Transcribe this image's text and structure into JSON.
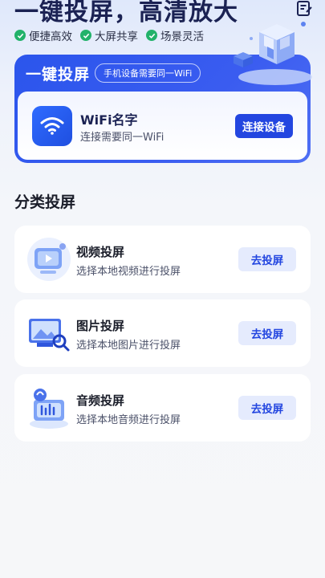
{
  "hero": {
    "title": "一键投屏，高清放大",
    "features": [
      "便捷高效",
      "大屏共享",
      "场景灵活"
    ]
  },
  "cast": {
    "title": "一键投屏",
    "tip": "手机设备需要同一WiFi",
    "wifi_name": "WiFi名字",
    "wifi_sub": "连接需要同一WiFi",
    "connect_label": "连接设备"
  },
  "section": {
    "title": "分类投屏"
  },
  "categories": [
    {
      "title": "视频投屏",
      "subtitle": "选择本地视频进行投屏",
      "button": "去投屏",
      "icon": "video-cast-icon"
    },
    {
      "title": "图片投屏",
      "subtitle": "选择本地图片进行投屏",
      "button": "去投屏",
      "icon": "image-cast-icon"
    },
    {
      "title": "音频投屏",
      "subtitle": "选择本地音频进行投屏",
      "button": "去投屏",
      "icon": "audio-cast-icon"
    }
  ],
  "colors": {
    "primary": "#2346e0",
    "check": "#22b26a",
    "button_light": "#e5ebfd"
  }
}
